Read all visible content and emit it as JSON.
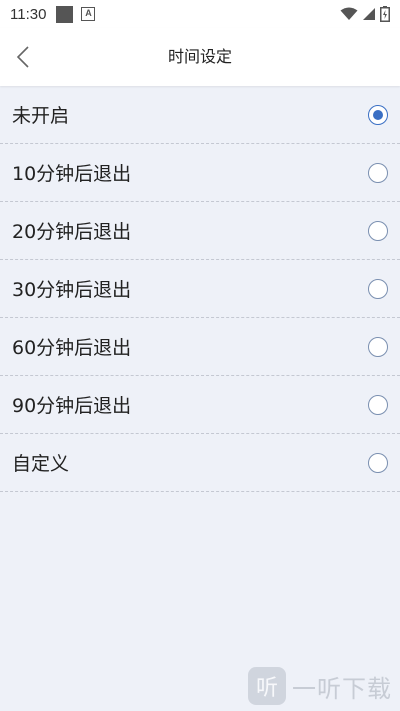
{
  "status_bar": {
    "time": "11:30",
    "icons": [
      "square-notification-icon",
      "a-notification-icon",
      "wifi-icon",
      "signal-icon",
      "battery-icon"
    ]
  },
  "header": {
    "title": "时间设定",
    "back_icon": "chevron-left-icon"
  },
  "options": [
    {
      "label": "未开启",
      "checked": true
    },
    {
      "label": "10分钟后退出",
      "checked": false
    },
    {
      "label": "20分钟后退出",
      "checked": false
    },
    {
      "label": "30分钟后退出",
      "checked": false
    },
    {
      "label": "60分钟后退出",
      "checked": false
    },
    {
      "label": "90分钟后退出",
      "checked": false
    },
    {
      "label": "自定义",
      "checked": false
    }
  ],
  "watermark": {
    "icon_char": "听",
    "text": "一听下载"
  },
  "colors": {
    "background": "#eef1f8",
    "accent": "#3a6fc4",
    "divider": "#c4c8d2"
  }
}
